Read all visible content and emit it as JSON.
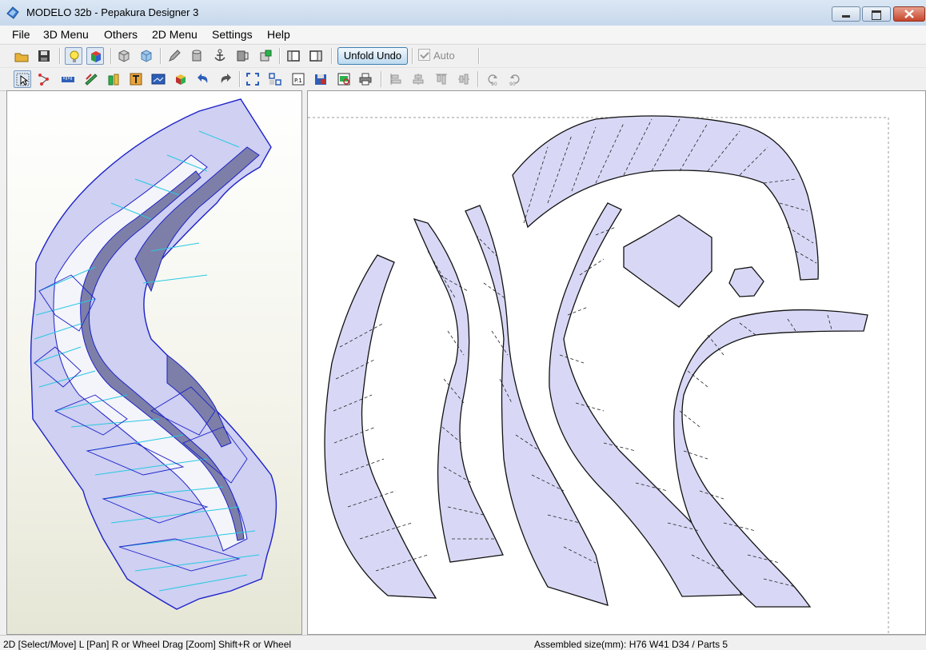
{
  "window": {
    "title": "MODELO 32b - Pepakura Designer 3"
  },
  "menu": {
    "items": [
      "File",
      "3D Menu",
      "Others",
      "2D Menu",
      "Settings",
      "Help"
    ]
  },
  "toolbar": {
    "unfold_undo_label": "Unfold Undo",
    "auto_label": "Auto",
    "auto_checked": true
  },
  "status": {
    "left": "2D [Select/Move] L [Pan] R or Wheel Drag [Zoom] Shift+R or Wheel",
    "right": "Assembled size(mm): H76 W41 D34 / Parts 5"
  },
  "icons": {
    "toolbar1": [
      "open-folder-icon",
      "save-icon",
      "light-bulb-icon",
      "color-cube-icon",
      "wire-cube-icon",
      "shaded-cube-icon",
      "pencil-icon",
      "cylinder-icon",
      "anchor-icon",
      "flap-icon",
      "green-box-icon",
      "single-pane-icon",
      "split-pane-icon"
    ],
    "toolbar2": [
      "select-arrow-icon",
      "edge-select-icon",
      "ruler-icon",
      "edit-tool-icon",
      "join-icon",
      "text-icon",
      "image-icon",
      "rotate-part-icon",
      "undo-icon",
      "redo-icon",
      "fit-icon",
      "arrange-icon",
      "page-icon",
      "save-pdf-icon",
      "print-preview-icon",
      "print-icon",
      "align-left-icon",
      "align-center-icon",
      "align-top-icon",
      "align-middle-icon",
      "rotate-ccw-90-icon",
      "rotate-cw-90-icon"
    ]
  },
  "colors": {
    "part_fill": "#d8d8f6",
    "model_edge": "#1c22c8",
    "fold_line": "#27c9e0"
  }
}
